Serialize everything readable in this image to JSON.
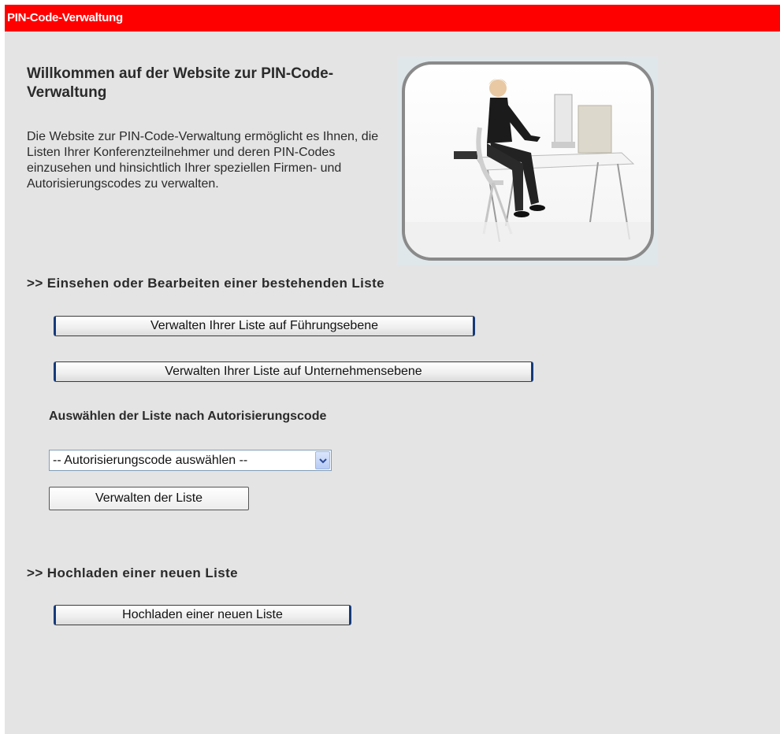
{
  "header": {
    "title": "PIN-Code-Verwaltung"
  },
  "welcome": {
    "title": "Willkommen auf der Website zur PIN-Code-Verwaltung",
    "text": "Die Website zur PIN-Code-Verwaltung ermöglicht es Ihnen, die Listen Ihrer Konferenzteilnehmer und deren PIN-Codes einzusehen und hinsichtlich Ihrer speziellen Firmen- und Autorisierungscodes zu verwalten."
  },
  "existing_list": {
    "heading": ">> Einsehen oder Bearbeiten einer bestehenden Liste",
    "manage_management_label": "Verwalten Ihrer Liste auf Führungsebene",
    "manage_company_label": "Verwalten Ihrer Liste auf Unternehmensebene",
    "select_by_code_label": "Auswählen der Liste nach Autorisierungscode",
    "auth_code_select": {
      "selected": "-- Autorisierungscode auswählen --"
    },
    "manage_list_label": "Verwalten der Liste"
  },
  "upload": {
    "heading": ">> Hochladen einer neuen Liste",
    "button_label": "Hochladen einer neuen Liste"
  },
  "colors": {
    "header_bg": "#ff0000",
    "page_bg": "#e4e4e4",
    "button_border_accent": "#163a7a"
  }
}
